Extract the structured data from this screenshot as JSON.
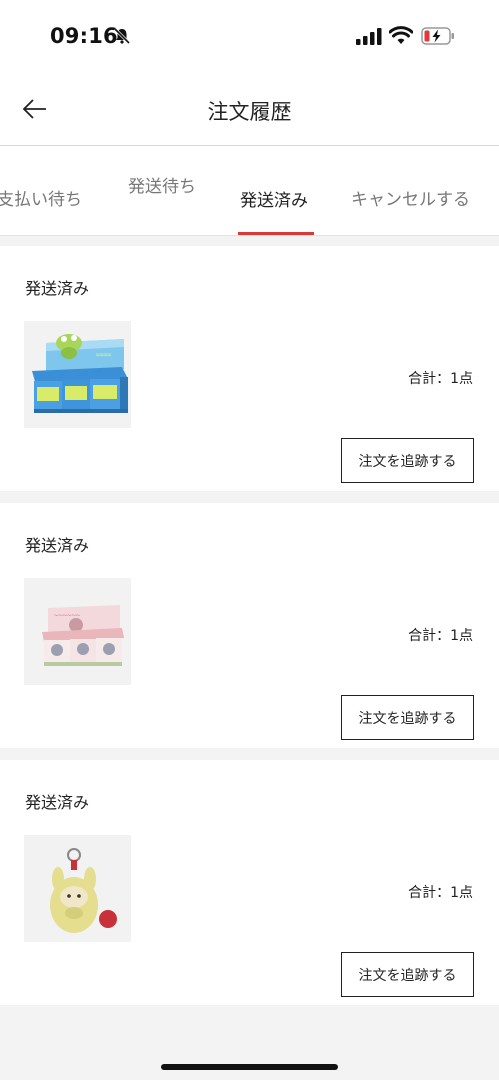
{
  "status_bar": {
    "time": "09:16"
  },
  "header": {
    "title": "注文履歴"
  },
  "tabs": [
    {
      "label": "支払い待ち",
      "active": false
    },
    {
      "label": "発送待ち",
      "active": false
    },
    {
      "label": "発送済み",
      "active": true
    },
    {
      "label": "キャンセルする",
      "active": false
    }
  ],
  "orders": [
    {
      "status": "発送済み",
      "total": "合計：1点",
      "button": "注文を追跡する",
      "image": "toy-blind-box-set-blue"
    },
    {
      "status": "発送済み",
      "total": "合計：1点",
      "button": "注文を追跡する",
      "image": "toy-blind-box-set-pink"
    },
    {
      "status": "発送済み",
      "total": "合計：1点",
      "button": "注文を追跡する",
      "image": "plush-keychain-yellow"
    }
  ],
  "colors": {
    "accent": "#d83a3a",
    "background": "#f3f3f3"
  }
}
